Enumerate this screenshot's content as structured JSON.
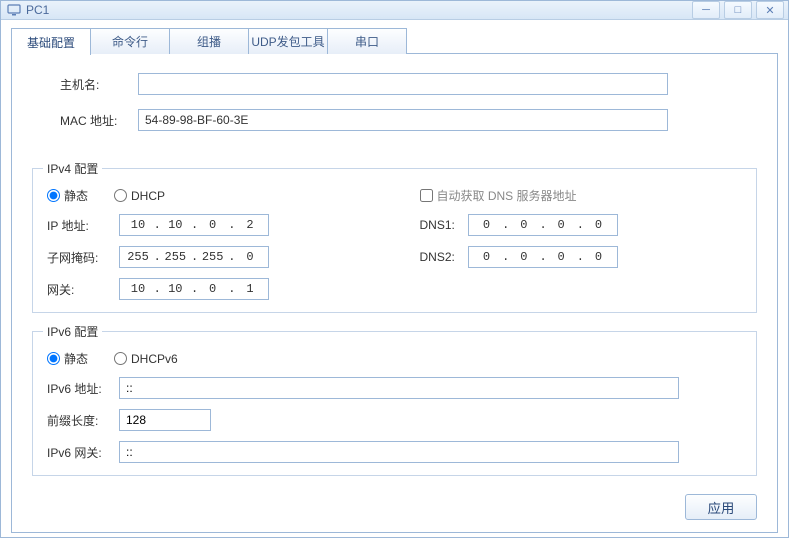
{
  "window": {
    "title": "PC1"
  },
  "tabs": [
    "基础配置",
    "命令行",
    "组播",
    "UDP发包工具",
    "串口"
  ],
  "active_tab": 0,
  "host": {
    "hostname_label": "主机名:",
    "hostname_value": "",
    "mac_label": "MAC 地址:",
    "mac_value": "54-89-98-BF-60-3E"
  },
  "ipv4": {
    "legend": "IPv4 配置",
    "static_label": "静态",
    "dhcp_label": "DHCP",
    "auto_dns_label": "自动获取 DNS 服务器地址",
    "ip_label": "IP 地址:",
    "ip": [
      "10",
      "10",
      "0",
      "2"
    ],
    "mask_label": "子网掩码:",
    "mask": [
      "255",
      "255",
      "255",
      "0"
    ],
    "gw_label": "网关:",
    "gw": [
      "10",
      "10",
      "0",
      "1"
    ],
    "dns1_label": "DNS1:",
    "dns1": [
      "0",
      "0",
      "0",
      "0"
    ],
    "dns2_label": "DNS2:",
    "dns2": [
      "0",
      "0",
      "0",
      "0"
    ]
  },
  "ipv6": {
    "legend": "IPv6 配置",
    "static_label": "静态",
    "dhcp_label": "DHCPv6",
    "addr_label": "IPv6 地址:",
    "addr_value": "::",
    "prefix_label": "前缀长度:",
    "prefix_value": "128",
    "gw_label": "IPv6 网关:",
    "gw_value": "::"
  },
  "footer": {
    "apply_label": "应用"
  }
}
